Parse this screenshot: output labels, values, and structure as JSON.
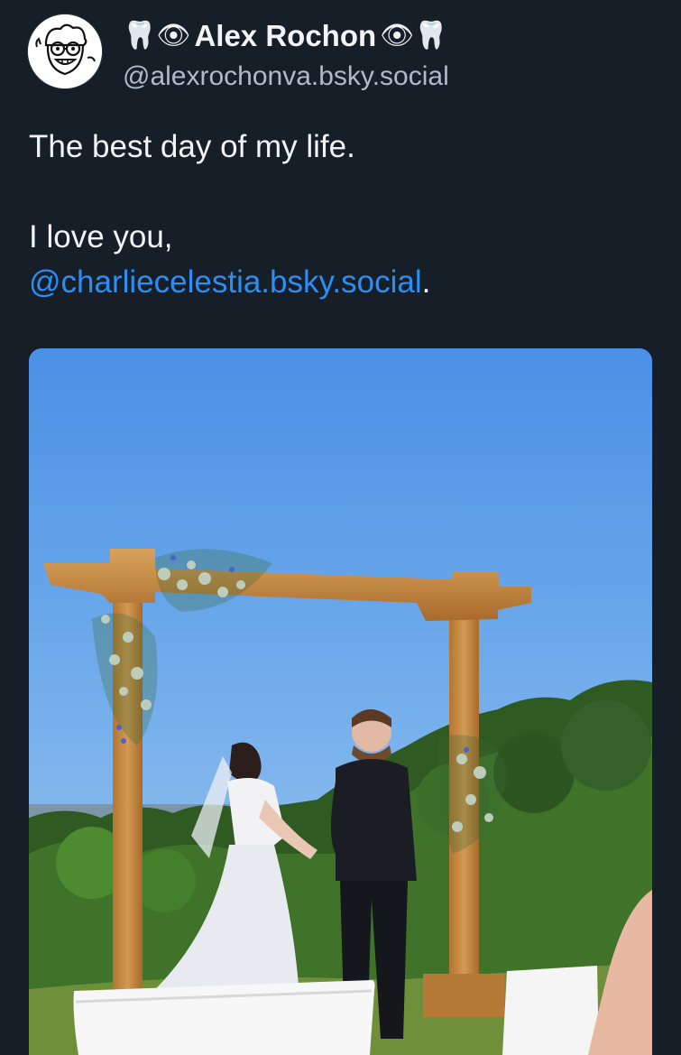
{
  "post": {
    "author": {
      "display_name": "Alex Rochon",
      "handle": "@alexrochonva.bsky.social",
      "name_prefix_emoji": "🦷👁",
      "name_suffix_emoji": "👁🦷",
      "avatar_icon": "cartoon-face-avatar-icon"
    },
    "text": {
      "line1": "The best day of my life.",
      "line2": "I love you,",
      "mention": "@charliecelestia.bsky.social",
      "mention_suffix": "."
    },
    "media": {
      "type": "photo",
      "subject": "wedding-ceremony-photo"
    }
  },
  "colors": {
    "background": "#161e27",
    "text": "#f1f3f5",
    "handle": "#aebbc9",
    "link": "#2b8ef5"
  }
}
